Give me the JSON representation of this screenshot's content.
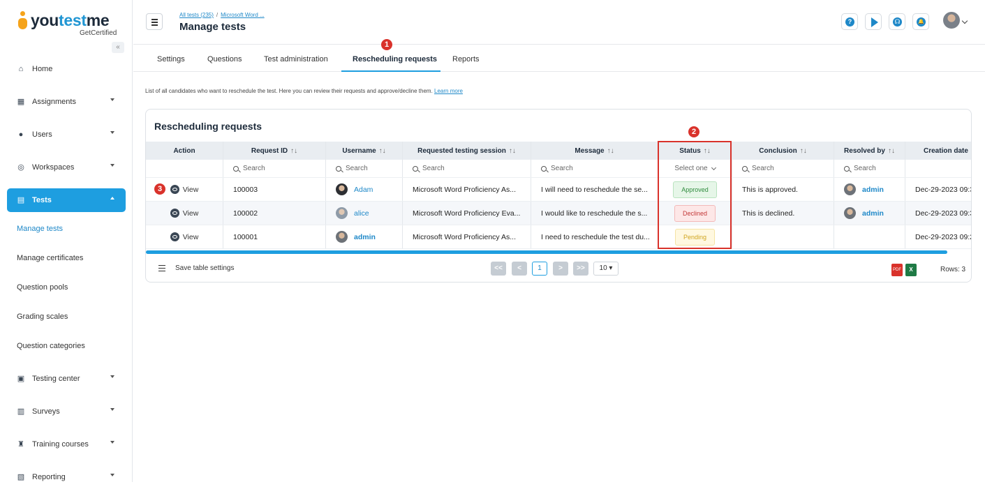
{
  "brand": {
    "name_prefix": "you",
    "name_accent": "test",
    "name_suffix": "me",
    "tagline": "GetCertified"
  },
  "sidebar": {
    "collapse_glyph": "«",
    "items": [
      {
        "label": "Home",
        "icon": "home-icon"
      },
      {
        "label": "Assignments",
        "icon": "assignments-icon"
      },
      {
        "label": "Users",
        "icon": "users-icon"
      },
      {
        "label": "Workspaces",
        "icon": "globe-icon"
      },
      {
        "label": "Tests",
        "icon": "tests-icon"
      },
      {
        "label": "Testing center",
        "icon": "calendar-icon"
      },
      {
        "label": "Surveys",
        "icon": "survey-icon"
      },
      {
        "label": "Training courses",
        "icon": "trophy-icon"
      },
      {
        "label": "Reporting",
        "icon": "report-icon"
      }
    ],
    "sub_items": [
      "Manage tests",
      "Manage certificates",
      "Question pools",
      "Grading scales",
      "Question categories"
    ]
  },
  "header": {
    "breadcrumb": [
      "All tests (235)",
      "Microsoft Word ..."
    ],
    "breadcrumb_sep": "/",
    "title": "Manage tests",
    "help_glyph": "?",
    "support_glyph": "☊",
    "bell_glyph": "🔔"
  },
  "tabs": [
    "Settings",
    "Questions",
    "Test administration",
    "Rescheduling requests",
    "Reports"
  ],
  "markers": [
    "1",
    "2",
    "3"
  ],
  "description": "List of all candidates who want to reschedule the test. Here you can review their requests and approve/decline them.",
  "learn_more": "Learn more",
  "table": {
    "title": "Rescheduling requests",
    "sort_glyph": "↑↓",
    "columns": [
      "Action",
      "Request ID",
      "Username",
      "Requested testing session",
      "Message",
      "Status",
      "Conclusion",
      "Resolved by",
      "Creation date"
    ],
    "filter_placeholder": "Search",
    "status_filter": "Select one",
    "view_label": "View",
    "rows": [
      {
        "id": "100003",
        "username": "Adam",
        "session": "Microsoft Word Proficiency As...",
        "message": "I will need to reschedule the se...",
        "status": "Approved",
        "conclusion": "This is approved.",
        "resolved_by": "admin",
        "created": "Dec-29-2023 09:3"
      },
      {
        "id": "100002",
        "username": "alice",
        "session": "Microsoft Word Proficiency Eva...",
        "message": "I would like to reschedule the s...",
        "status": "Declined",
        "conclusion": "This is declined.",
        "resolved_by": "admin",
        "created": "Dec-29-2023 09:3"
      },
      {
        "id": "100001",
        "username": "admin",
        "session": "Microsoft Word Proficiency As...",
        "message": "I need to reschedule the test du...",
        "status": "Pending",
        "conclusion": "",
        "resolved_by": "",
        "created": "Dec-29-2023 09:2"
      }
    ],
    "save_settings": "Save table settings",
    "pager": {
      "first": "<<",
      "prev": "<",
      "current": "1",
      "next": ">",
      "last": ">>",
      "page_size": "10"
    },
    "export_pdf": "PDF",
    "export_xls": "X",
    "rows_label": "Rows: 3"
  },
  "colors": {
    "accent": "#1e9ee0",
    "marker": "#d9322b"
  }
}
